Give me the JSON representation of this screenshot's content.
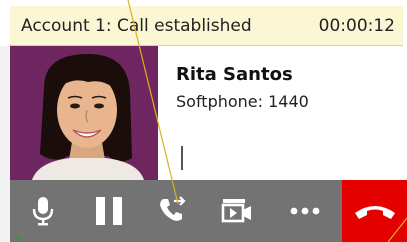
{
  "status": {
    "text": "Account 1: Call established",
    "timer": "00:00:12"
  },
  "contact": {
    "name": "Rita Santos",
    "detail": "Softphone: 1440"
  },
  "toolbar": {
    "buttons": [
      "microphone-icon",
      "pause-icon",
      "transfer-call-icon",
      "video-icon",
      "more-options-icon",
      "hang-up-icon"
    ]
  },
  "colors": {
    "status_bar": "#fbf6d3",
    "avatar_bg": "#6d2660",
    "toolbar": "#737373",
    "hangup": "#e50000",
    "annotation": "#d9b21a"
  }
}
